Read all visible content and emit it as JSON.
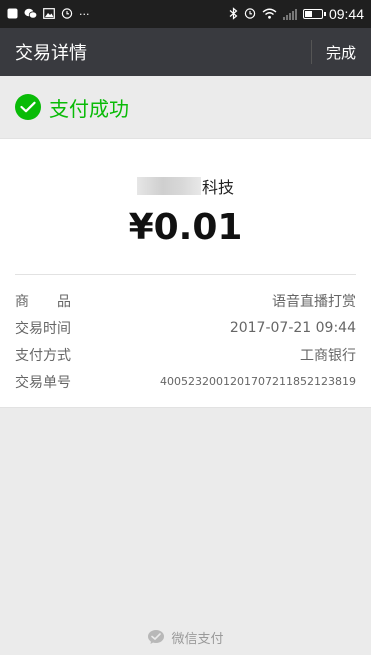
{
  "status_bar": {
    "time": "09:44",
    "battery_level": 0.45,
    "left_icons": [
      "notification-icon",
      "wechat-icon",
      "image-icon",
      "alarm-icon",
      "more-icon"
    ],
    "right_icons": [
      "bluetooth-icon",
      "alarm-icon",
      "wifi-icon",
      "signal-icon",
      "battery-icon"
    ]
  },
  "nav": {
    "title": "交易详情",
    "done_label": "完成"
  },
  "status": {
    "text": "支付成功",
    "color": "#09bb07"
  },
  "merchant": {
    "name_visible": "科技"
  },
  "amount": "¥0.01",
  "details": [
    {
      "label": "商　　品",
      "value": "语音直播打赏"
    },
    {
      "label": "交易时间",
      "value": "2017-07-21 09:44"
    },
    {
      "label": "支付方式",
      "value": "工商银行"
    },
    {
      "label": "交易单号",
      "value": "4005232001201707211852123819"
    }
  ],
  "footer": {
    "text": "微信支付"
  }
}
